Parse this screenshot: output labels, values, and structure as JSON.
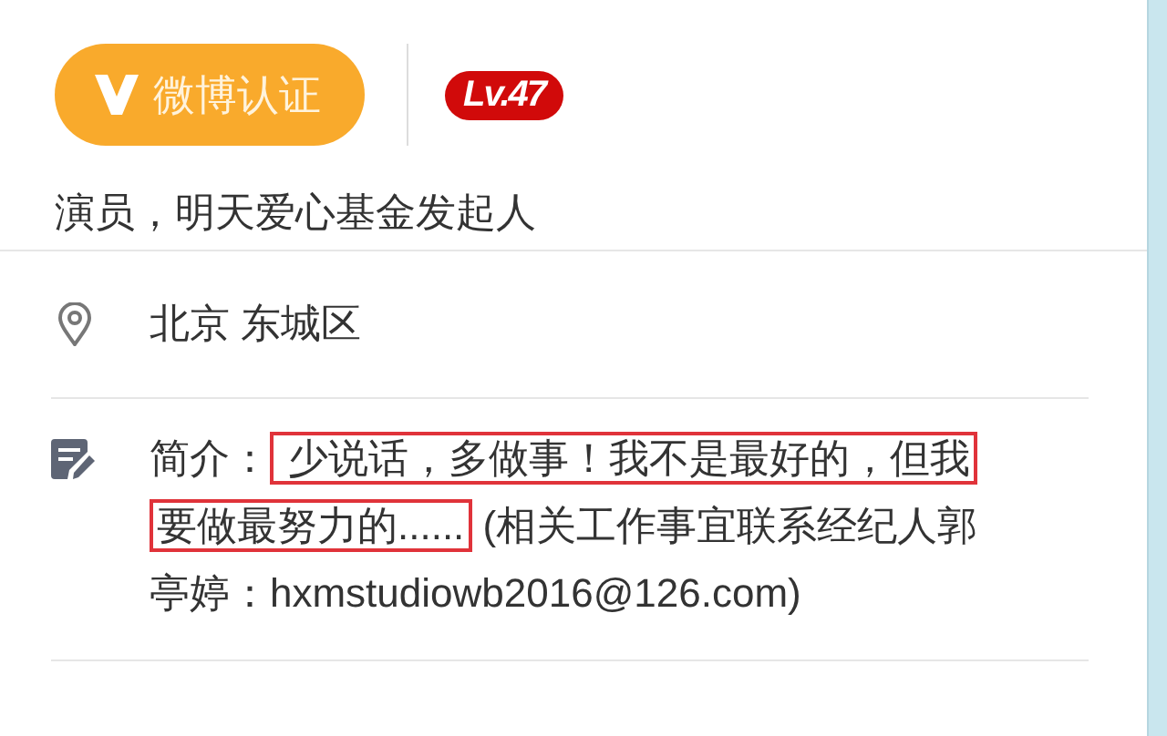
{
  "verified_badge": {
    "label": "微博认证"
  },
  "level_badge": {
    "label": "Lv.47"
  },
  "title": "演员，明天爱心基金发起人",
  "location": {
    "text": "北京 东城区"
  },
  "bio": {
    "segments": [
      {
        "text": "简介：",
        "highlighted": false
      },
      {
        "text": " 少说话，多做事！我不是最好的，但我要做最努力的......",
        "highlighted": true
      },
      {
        "text": " (相关工作事宜联系经纪人郭亭婷：hxmstudiowb2016@126.com)",
        "highlighted": false
      }
    ]
  }
}
